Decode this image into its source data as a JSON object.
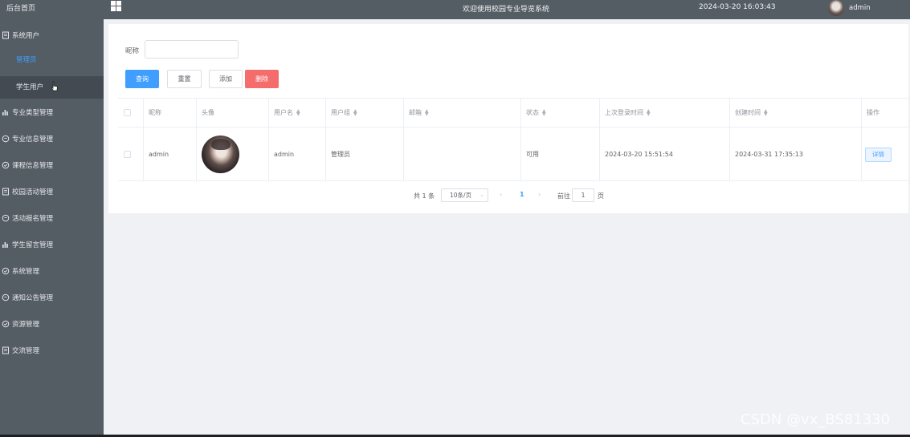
{
  "sidebar": {
    "home": "后台首页",
    "menu": [
      {
        "label": "系统用户",
        "icon": "document-icon"
      },
      {
        "label": "专业类型管理",
        "icon": "bar-chart-icon"
      },
      {
        "label": "专业信息管理",
        "icon": "chat-icon"
      },
      {
        "label": "课程信息管理",
        "icon": "check-circle-icon"
      },
      {
        "label": "校园活动管理",
        "icon": "document-icon"
      },
      {
        "label": "活动报名管理",
        "icon": "chat-icon"
      },
      {
        "label": "学生留言管理",
        "icon": "bar-chart-icon"
      },
      {
        "label": "系统管理",
        "icon": "check-circle-icon"
      },
      {
        "label": "通知公告管理",
        "icon": "chat-icon"
      },
      {
        "label": "资源管理",
        "icon": "check-circle-icon"
      },
      {
        "label": "交流管理",
        "icon": "document-icon"
      }
    ],
    "submenu": [
      "管理员",
      "学生用户"
    ]
  },
  "header": {
    "title": "欢迎使用校园专业导览系统",
    "datetime": "2024-03-20 16:03:43",
    "username": "admin"
  },
  "search": {
    "label": "昵称",
    "value": ""
  },
  "buttons": {
    "query": "查询",
    "reset": "重置",
    "add": "添加",
    "delete": "删除"
  },
  "table": {
    "headers": [
      "昵称",
      "头像",
      "用户名",
      "用户组",
      "邮箱",
      "状态",
      "上次登录时间",
      "创建时间",
      "操作"
    ],
    "rows": [
      {
        "nickname": "admin",
        "username": "admin",
        "group": "管理员",
        "email": "",
        "status": "可用",
        "last_login": "2024-03-20 15:51:54",
        "created": "2024-03-31 17:35:13",
        "action": "详情"
      }
    ]
  },
  "pagination": {
    "total": "共 1 条",
    "page_size": "10条/页",
    "prev": "‹",
    "current": "1",
    "next": "›",
    "goto": "前往",
    "jump_value": "1",
    "unit": "页"
  },
  "watermark": "CSDN @vx_BS81330"
}
